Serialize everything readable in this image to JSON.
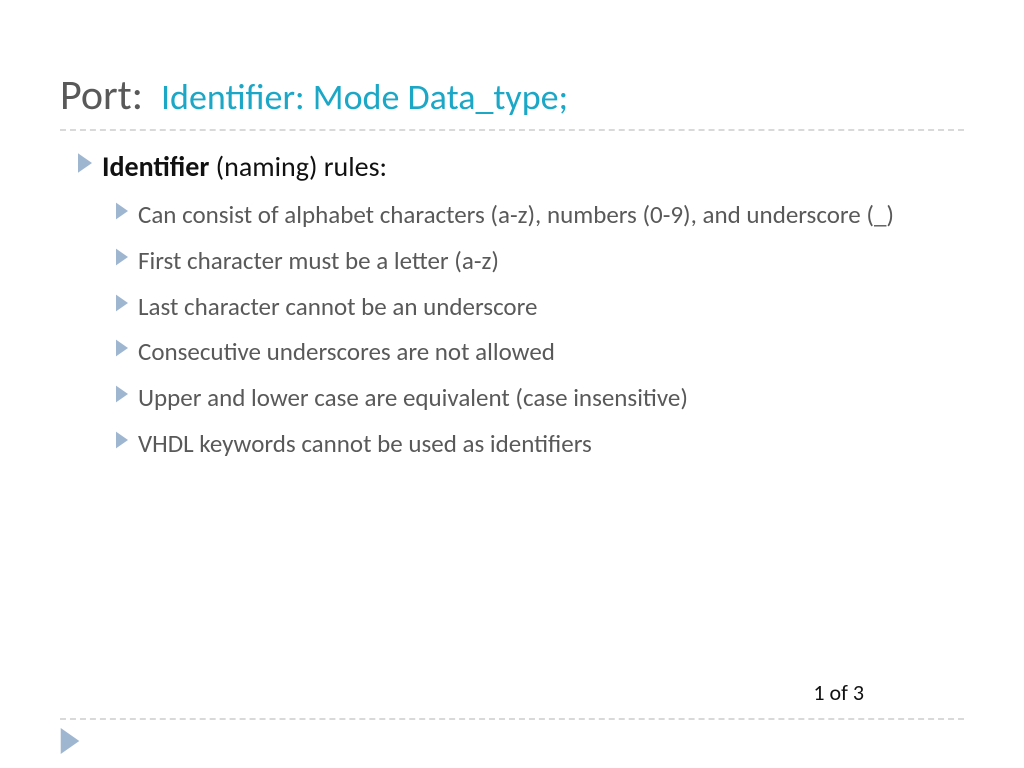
{
  "title": {
    "main": "Port:",
    "sub": "Identifier:  Mode  Data_type;"
  },
  "heading": {
    "strong": "Identifier",
    "rest": " (naming) rules:"
  },
  "rules": [
    "Can consist of alphabet characters (a-z), numbers (0-9), and underscore (_)",
    "First character must be a letter (a-z)",
    "Last character cannot be an underscore",
    "Consecutive underscores are not allowed",
    "Upper and lower case are equivalent (case insensitive)",
    "VHDL keywords cannot be used as identifiers"
  ],
  "page_indicator": "1 of 3"
}
